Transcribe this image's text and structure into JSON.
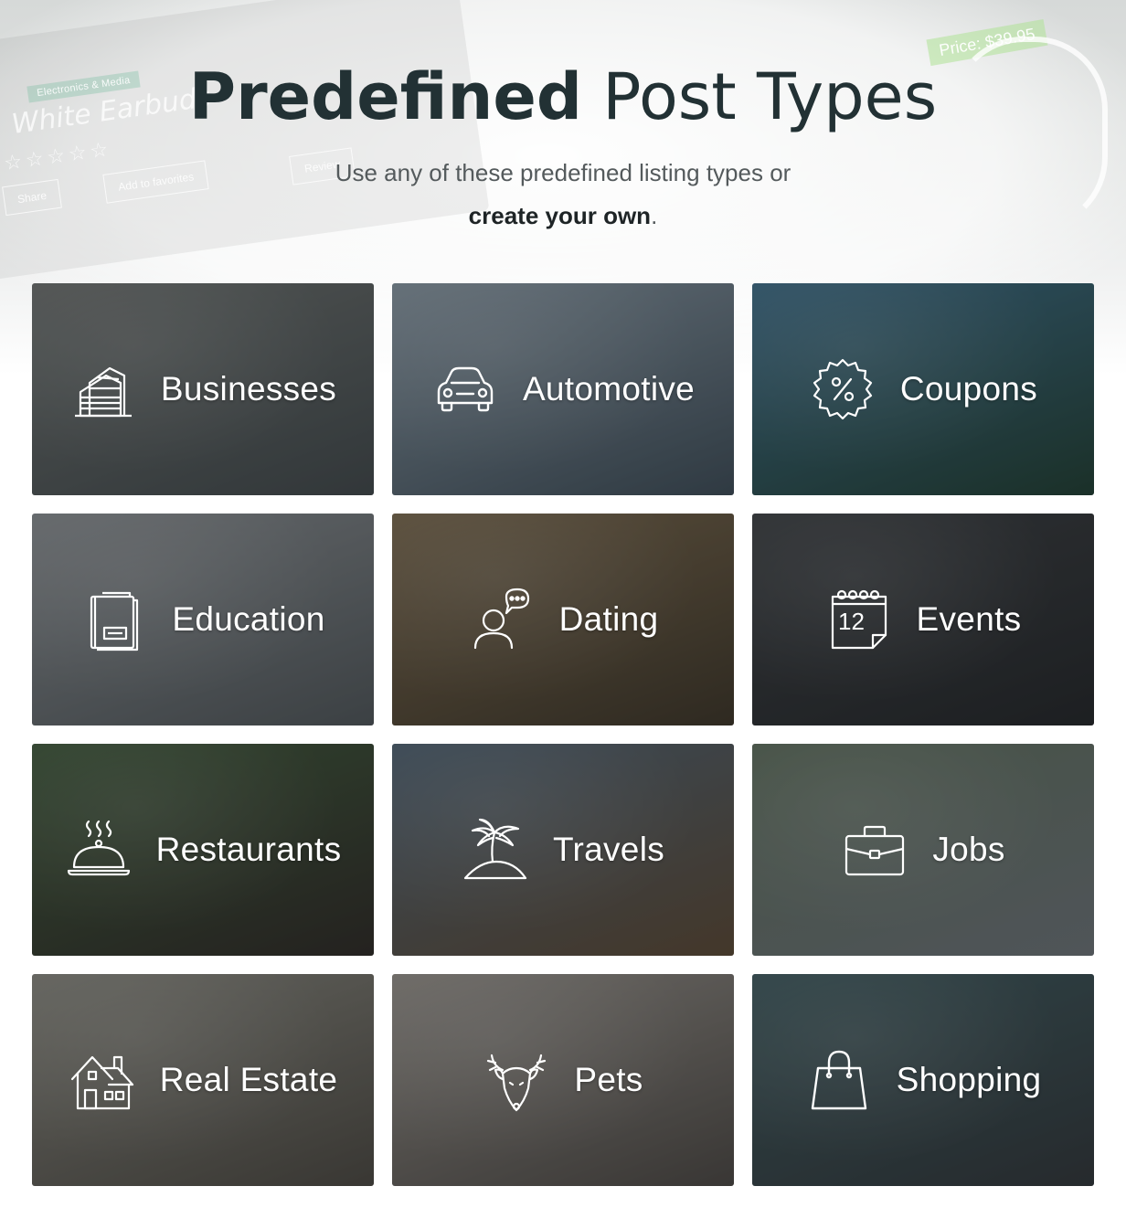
{
  "header": {
    "title_strong": "Predefined",
    "title_light": "Post Types",
    "subtitle_line1": "Use any of these predefined listing types or",
    "subtitle_bold": "create your own",
    "subtitle_end": "."
  },
  "background_card": {
    "tag": "Electronics & Media",
    "product": "White Earbuds",
    "stars": "☆☆☆☆☆",
    "share": "Share",
    "favorites": "Add to favorites",
    "review": "Review",
    "price": "Price: $39.95"
  },
  "tiles": [
    {
      "label": "Businesses",
      "icon": "building-icon",
      "bg": [
        "#6e726f",
        "#3f4648"
      ]
    },
    {
      "label": "Automotive",
      "icon": "car-icon",
      "bg": [
        "#8a9aa6",
        "#3b4a55"
      ]
    },
    {
      "label": "Coupons",
      "icon": "coupon-badge-icon",
      "bg": [
        "#3c6f8c",
        "#1c3b2e"
      ]
    },
    {
      "label": "Education",
      "icon": "book-icon",
      "bg": [
        "#8d9194",
        "#4e5457"
      ]
    },
    {
      "label": "Dating",
      "icon": "person-chat-icon",
      "bg": [
        "#7e6a4c",
        "#3a3122"
      ]
    },
    {
      "label": "Events",
      "icon": "calendar-icon",
      "bg": [
        "#3a3d40",
        "#1f2123"
      ]
    },
    {
      "label": "Restaurants",
      "icon": "cloche-icon",
      "bg": [
        "#3f5a38",
        "#2a2520"
      ]
    },
    {
      "label": "Travels",
      "icon": "palm-island-icon",
      "bg": [
        "#4e6273",
        "#5a4630"
      ]
    },
    {
      "label": "Jobs",
      "icon": "briefcase-icon",
      "bg": [
        "#5e6f5b",
        "#6d7378"
      ]
    },
    {
      "label": "Real Estate",
      "icon": "house-icon",
      "bg": [
        "#8c8a80",
        "#4a463e"
      ]
    },
    {
      "label": "Pets",
      "icon": "deer-icon",
      "bg": [
        "#9a948c",
        "#4a4540"
      ]
    },
    {
      "label": "Shopping",
      "icon": "shopping-bag-icon",
      "bg": [
        "#3d5a5e",
        "#2d3235"
      ]
    }
  ]
}
